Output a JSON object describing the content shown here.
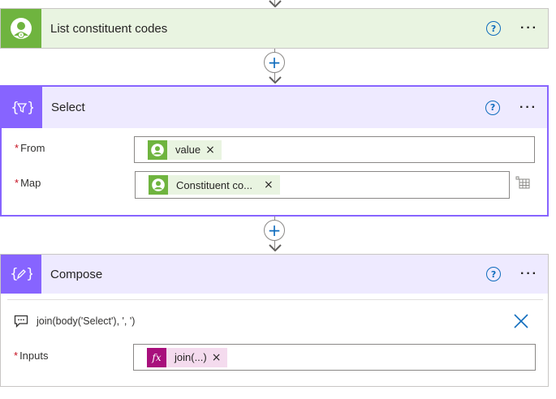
{
  "list_card": {
    "title": "List constituent codes",
    "help_label": "?",
    "more_label": "···"
  },
  "select_card": {
    "title": "Select",
    "help_label": "?",
    "more_label": "···",
    "fields": [
      {
        "required_mark": "*",
        "label": "From",
        "token": "value",
        "remove": "×"
      },
      {
        "required_mark": "*",
        "label": "Map",
        "token": "Constituent co...",
        "remove": "×"
      }
    ]
  },
  "compose_card": {
    "title": "Compose",
    "help_label": "?",
    "more_label": "···",
    "comment": "join(body('Select'), ', ')",
    "input_field": {
      "required_mark": "*",
      "label": "Inputs",
      "token": "join(...)",
      "remove": "×",
      "token_icon": "fx"
    }
  },
  "connectors": {
    "add_label": "+"
  },
  "colors": {
    "bh_green": "#6fb43f",
    "bh_header_bg": "#e9f4e1",
    "data_op_purple": "#8764ff",
    "data_op_header_bg": "#eeeaff",
    "expression_magenta": "#a80f7c",
    "expression_token_bg": "#f4dbee",
    "accent_blue": "#0f6cbd"
  }
}
